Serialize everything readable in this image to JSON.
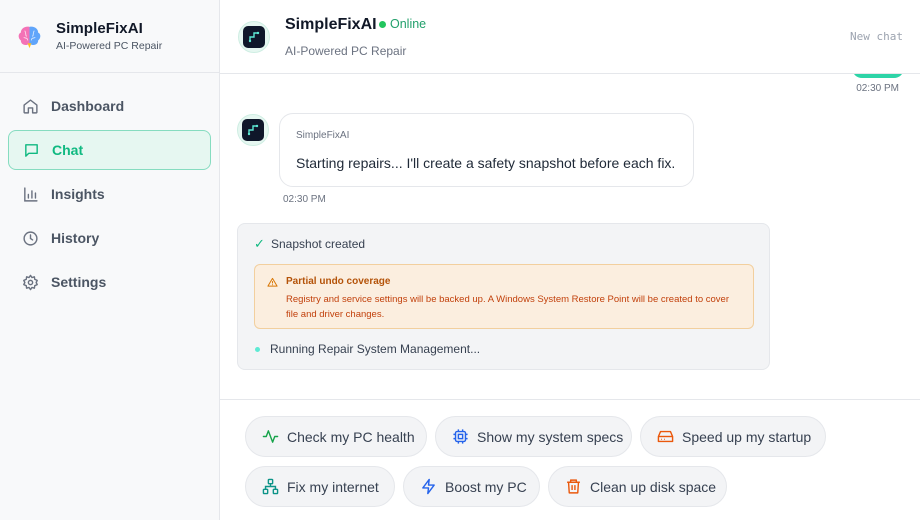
{
  "brand": {
    "name": "SimpleFixAI",
    "tagline": "AI-Powered PC Repair"
  },
  "sidebar": {
    "items": [
      {
        "label": "Dashboard",
        "icon": "home-icon"
      },
      {
        "label": "Chat",
        "icon": "chat-icon",
        "active": true
      },
      {
        "label": "Insights",
        "icon": "bar-chart-icon"
      },
      {
        "label": "History",
        "icon": "clock-icon"
      },
      {
        "label": "Settings",
        "icon": "gear-icon"
      }
    ]
  },
  "header": {
    "title": "SimpleFixAI",
    "status": "Online",
    "subtitle": "AI-Powered PC Repair",
    "new_chat": "New chat"
  },
  "chat": {
    "user_timestamp": "02:30 PM",
    "bot_message": {
      "sender": "SimpleFixAI",
      "text": "Starting repairs... I'll create a safety snapshot before each fix.",
      "timestamp": "02:30 PM"
    },
    "status": {
      "snapshot": "Snapshot created",
      "warning_title": "Partial undo coverage",
      "warning_body": "Registry and service settings will be backed up. A Windows System Restore Point will be created to cover file and driver changes.",
      "running": "Running Repair System Management..."
    }
  },
  "quick_actions": [
    {
      "label": "Check my PC health",
      "icon": "activity-icon",
      "color": "#16a34a"
    },
    {
      "label": "Show my system specs",
      "icon": "cpu-icon",
      "color": "#2563eb"
    },
    {
      "label": "Speed up my startup",
      "icon": "hard-drive-icon",
      "color": "#ea580c"
    },
    {
      "label": "Fix my internet",
      "icon": "network-icon",
      "color": "#0d9488"
    },
    {
      "label": "Boost my PC",
      "icon": "lightning-icon",
      "color": "#2563eb"
    },
    {
      "label": "Clean up disk space",
      "icon": "trash-icon",
      "color": "#ea580c"
    }
  ],
  "colors": {
    "accent": "#10b981",
    "warning_bg": "#fbeedf",
    "warning_text": "#b45309"
  }
}
